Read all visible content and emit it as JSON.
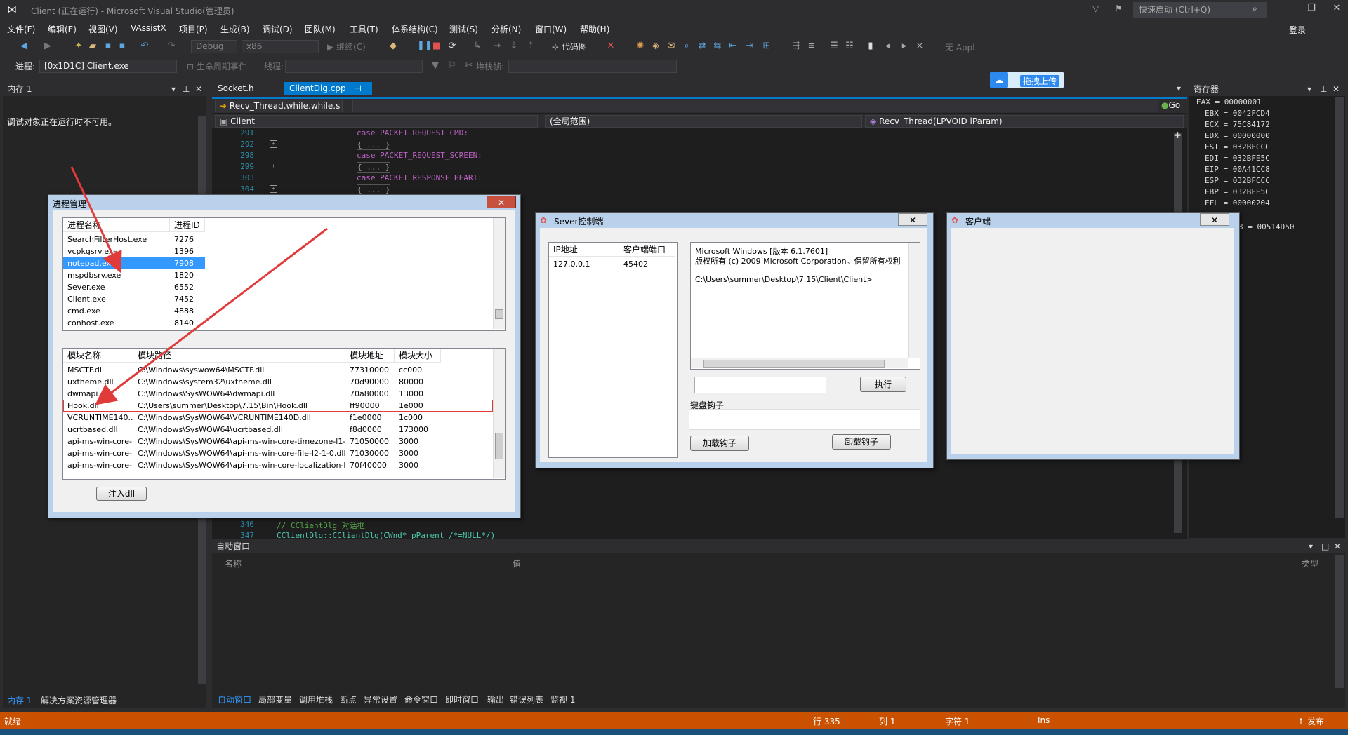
{
  "window": {
    "title": "Client (正在运行) - Microsoft Visual Studio(管理员)",
    "quick_launch_placeholder": "快速启动 (Ctrl+Q)"
  },
  "menu": {
    "items": [
      "文件(F)",
      "编辑(E)",
      "视图(V)",
      "VAssistX",
      "项目(P)",
      "生成(B)",
      "调试(D)",
      "团队(M)",
      "工具(T)",
      "体系结构(C)",
      "测试(S)",
      "分析(N)",
      "窗口(W)",
      "帮助(H)"
    ],
    "login": "登录"
  },
  "toolbar": {
    "config": "Debug",
    "platform": "x86",
    "continue": "继续(C)",
    "code_map": "代码图",
    "upload": "拖拽上传",
    "apply": "无 Appl",
    "process_label": "进程:",
    "process_value": "[0x1D1C] Client.exe",
    "lifecycle_label": "生命周期事件",
    "thread_label": "线程:",
    "stack_label": "堆栈帧:"
  },
  "left_panel": {
    "title": "内存 1",
    "message": "调试对象正在运行时不可用。",
    "tabs": [
      "内存 1",
      "解决方案资源管理器"
    ]
  },
  "editor": {
    "tabs": [
      "Socket.h",
      "ClientDlg.cpp"
    ],
    "nav_function": "Recv_Thread.while.while.s",
    "nav_go": "Go",
    "scope_project": "Client",
    "scope_global": "(全局范围)",
    "scope_method": "Recv_Thread(LPVOID lParam)",
    "lines": [
      {
        "num": "291",
        "code": "case PACKET_REQUEST_CMD:"
      },
      {
        "num": "292",
        "code": "{ ... }"
      },
      {
        "num": "298",
        "code": "case PACKET_REQUEST_SCREEN:"
      },
      {
        "num": "299",
        "code": "{ ... }"
      },
      {
        "num": "303",
        "code": "case PACKET_RESPONSE_HEART:"
      },
      {
        "num": "304",
        "code": "{ ... }"
      }
    ],
    "bottom_lines": [
      {
        "num": "346",
        "code": "// CClientDlg 对话框"
      },
      {
        "num": "347",
        "code": "CClientDlg::CClientDlg(CWnd* pParent /*=NULL*/)"
      }
    ]
  },
  "registers": {
    "title": "寄存器",
    "values": [
      "EAX = 00000001",
      "EBX = 0042FCD4",
      "ECX = 75C84172",
      "EDX = 00000000",
      "ESI = 032BFCCC",
      "EDI = 032BFE5C",
      "EIP = 00A41CC8",
      "ESP = 032BFCCC",
      "EBP = 032BFE5C",
      "EFL = 00000204"
    ],
    "extra": "8 = 00514D50"
  },
  "auto_window": {
    "title": "自动窗口",
    "col_name": "名称",
    "col_value": "值",
    "col_type": "类型"
  },
  "bottom_tabs": [
    "自动窗口",
    "局部变量",
    "调用堆栈",
    "断点",
    "异常设置",
    "命令窗口",
    "即时窗口",
    "输出",
    "错误列表",
    "监视 1"
  ],
  "status": {
    "ready": "就绪",
    "line": "行 335",
    "col": "列 1",
    "char": "字符 1",
    "ins": "Ins",
    "publish": "发布"
  },
  "process_dialog": {
    "title": "进程管理",
    "proc_headers": [
      "进程名称",
      "进程ID"
    ],
    "processes": [
      {
        "name": "SearchFilterHost.exe",
        "pid": "7276"
      },
      {
        "name": "vcpkgsrv.exe",
        "pid": "1396"
      },
      {
        "name": "notepad.exe",
        "pid": "7908"
      },
      {
        "name": "mspdbsrv.exe",
        "pid": "1820"
      },
      {
        "name": "Sever.exe",
        "pid": "6552"
      },
      {
        "name": "Client.exe",
        "pid": "7452"
      },
      {
        "name": "cmd.exe",
        "pid": "4888"
      },
      {
        "name": "conhost.exe",
        "pid": "8140"
      }
    ],
    "mod_headers": [
      "模块名称",
      "模块路径",
      "模块地址",
      "模块大小"
    ],
    "modules": [
      {
        "name": "MSCTF.dll",
        "path": "C:\\Windows\\syswow64\\MSCTF.dll",
        "addr": "77310000",
        "size": "cc000"
      },
      {
        "name": "uxtheme.dll",
        "path": "C:\\Windows\\system32\\uxtheme.dll",
        "addr": "70d90000",
        "size": "80000"
      },
      {
        "name": "dwmapi.dll",
        "path": "C:\\Windows\\SysWOW64\\dwmapi.dll",
        "addr": "70a80000",
        "size": "13000"
      },
      {
        "name": "Hook.dll",
        "path": "C:\\Users\\summer\\Desktop\\7.15\\Bin\\Hook.dll",
        "addr": "ff90000",
        "size": "1e000"
      },
      {
        "name": "VCRUNTIME140...",
        "path": "C:\\Windows\\SysWOW64\\VCRUNTIME140D.dll",
        "addr": "f1e0000",
        "size": "1c000"
      },
      {
        "name": "ucrtbased.dll",
        "path": "C:\\Windows\\SysWOW64\\ucrtbased.dll",
        "addr": "f8d0000",
        "size": "173000"
      },
      {
        "name": "api-ms-win-core-...",
        "path": "C:\\Windows\\SysWOW64\\api-ms-win-core-timezone-l1-1-...",
        "addr": "71050000",
        "size": "3000"
      },
      {
        "name": "api-ms-win-core-...",
        "path": "C:\\Windows\\SysWOW64\\api-ms-win-core-file-l2-1-0.dll",
        "addr": "71030000",
        "size": "3000"
      },
      {
        "name": "api-ms-win-core-...",
        "path": "C:\\Windows\\SysWOW64\\api-ms-win-core-localization-l1-...",
        "addr": "70f40000",
        "size": "3000"
      }
    ],
    "inject_button": "注入dll"
  },
  "server_dialog": {
    "title": "Sever控制端",
    "headers": [
      "IP地址",
      "客户端端口"
    ],
    "rows": [
      {
        "ip": "127.0.0.1",
        "port": "45402"
      }
    ],
    "console": [
      "Microsoft Windows [版本 6.1.7601]",
      "版权所有 (c) 2009 Microsoft Corporation。保留所有权利",
      "",
      "C:\\Users\\summer\\Desktop\\7.15\\Client\\Client>"
    ],
    "exec_button": "执行",
    "keyboard_hook_label": "键盘钩子",
    "load_hook_button": "加载钩子",
    "unload_hook_button": "卸载钩子"
  },
  "client_dialog": {
    "title": "客户端"
  },
  "colors": {
    "accent": "#007acc",
    "status_bar": "#ca5100",
    "selection": "#3399ff",
    "hook_highlight": "#e03a3a"
  }
}
